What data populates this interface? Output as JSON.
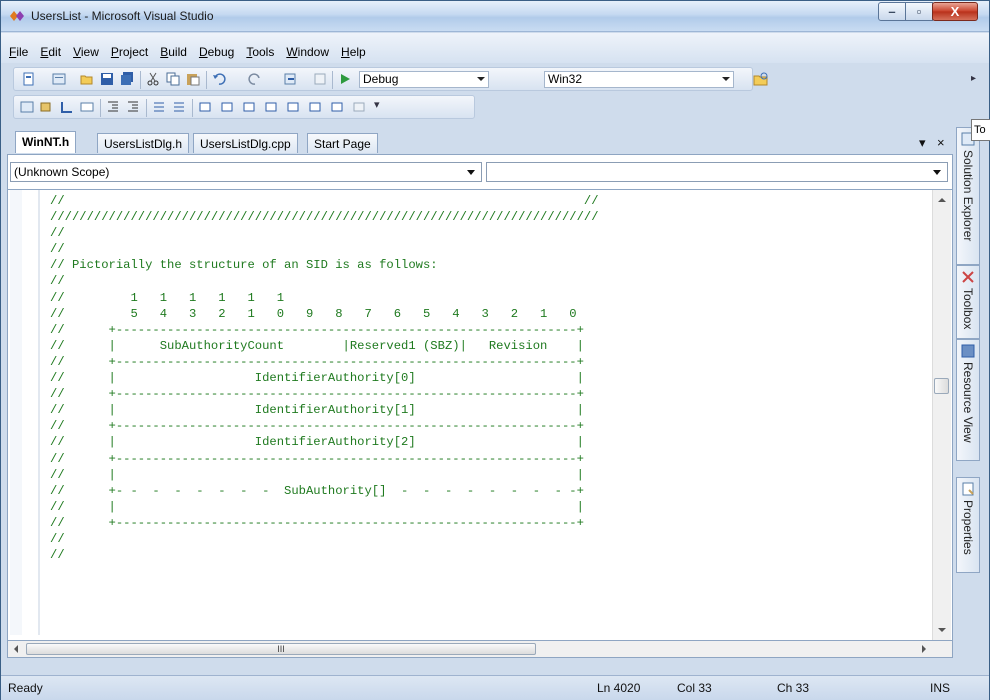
{
  "window": {
    "title": "UsersList - Microsoft Visual Studio",
    "buttons": {
      "minimize": "–",
      "maximize": "▫",
      "close": "X"
    }
  },
  "menu": [
    "File",
    "Edit",
    "View",
    "Project",
    "Build",
    "Debug",
    "Tools",
    "Window",
    "Help"
  ],
  "menu_mnemonic_index": [
    0,
    0,
    0,
    0,
    0,
    0,
    0,
    0,
    0
  ],
  "toolbar": {
    "config_value": "Debug",
    "platform_value": "Win32"
  },
  "tabs": [
    {
      "label": "WinNT.h",
      "active": true
    },
    {
      "label": "UsersListDlg.h",
      "active": false
    },
    {
      "label": "UsersListDlg.cpp",
      "active": false
    },
    {
      "label": "Start Page",
      "active": false
    }
  ],
  "tab_controls": {
    "dropdown": "▾",
    "close": "×"
  },
  "scope": {
    "left_value": "(Unknown Scope)",
    "right_value": ""
  },
  "code_lines": [
    "//                                                                       //",
    "///////////////////////////////////////////////////////////////////////////",
    "//",
    "//",
    "// Pictorially the structure of an SID is as follows:",
    "//",
    "//         1   1   1   1   1   1",
    "//         5   4   3   2   1   0   9   8   7   6   5   4   3   2   1   0",
    "//      +---------------------------------------------------------------+",
    "//      |      SubAuthorityCount        |Reserved1 (SBZ)|   Revision    |",
    "//      +---------------------------------------------------------------+",
    "//      |                   IdentifierAuthority[0]                      |",
    "//      +---------------------------------------------------------------+",
    "//      |                   IdentifierAuthority[1]                      |",
    "//      +---------------------------------------------------------------+",
    "//      |                   IdentifierAuthority[2]                      |",
    "//      +---------------------------------------------------------------+",
    "//      |                                                               |",
    "//      +- -  -  -  -  -  -  -  SubAuthority[]  -  -  -  -  -  -  -  - -+",
    "//      |                                                               |",
    "//      +---------------------------------------------------------------+",
    "//",
    "//"
  ],
  "hscroll_label": "III",
  "side_panels": [
    "Solution Explorer",
    "Toolbox",
    "Resource View",
    "Properties"
  ],
  "tooltip_stub": "To",
  "status": {
    "ready": "Ready",
    "ln": "Ln 4020",
    "col": "Col 33",
    "ch": "Ch 33",
    "ins": "INS"
  },
  "colors": {
    "comment": "#1f7a1f",
    "chrome": "#cfdcec"
  }
}
